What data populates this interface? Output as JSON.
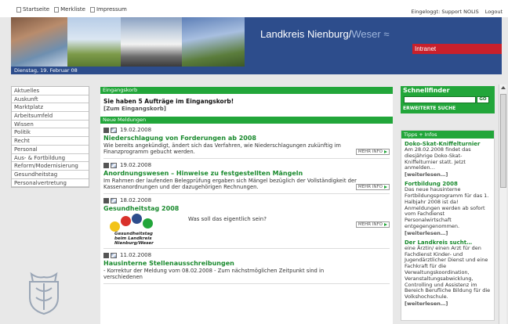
{
  "toplinks": [
    {
      "label": "Startseite",
      "icon": "home-icon"
    },
    {
      "label": "Merkliste",
      "icon": "doc-icon"
    },
    {
      "label": "Impressum",
      "icon": "doc-icon"
    }
  ],
  "user": {
    "logged_in": "Eingeloggt: Support NOLIS",
    "logout": "Logout"
  },
  "banner": {
    "title_main": "Landkreis Nienburg/",
    "title_accent": "Weser",
    "waves": "≈",
    "intranet": "Intranet",
    "date": "Dienstag, 19. Februar 08"
  },
  "nav": [
    "Aktuelles",
    "Auskunft",
    "Marktplatz",
    "Arbeitsumfeld",
    "Wissen",
    "Politik",
    "Recht",
    "Personal",
    "Aus- & Fortbildung",
    "Reform/Modernisierung",
    "Gesundheitstag",
    "Personalvertretung"
  ],
  "inbox": {
    "header": "Eingangskorb",
    "message": "Sie haben 5 Aufträge im Eingangskorb!",
    "link": "[Zum Eingangskorb]"
  },
  "news": {
    "header": "Neue Meldungen",
    "more_label": "MEHR INFO",
    "items": [
      {
        "date": "19.02.2008",
        "title": "Niederschlagung von Forderungen ab 2008",
        "text": "Wie bereits angekündigt, ändert sich das Verfahren, wie Niederschlagungen zukünftig im Finanzprogramm gebucht werden."
      },
      {
        "date": "19.02.2008",
        "title": "Anordnungswesen – Hinweise zu festgestellten Mängeln",
        "text": "Im Rahmen der laufenden Belegprüfung ergaben sich Mängel bezüglich der Vollständigkeit der Kassenanordnungen und der dazugehörigen Rechnungen."
      },
      {
        "date": "18.02.2008",
        "title": "Gesundheitstag 2008",
        "question": "Was soll das eigentlich sein?",
        "logo_line1": "Gesundheitstag",
        "logo_line2": "beim Landkreis Nienburg/Weser"
      },
      {
        "date": "11.02.2008",
        "title": "Hausinterne Stellenausschreibungen",
        "text": "- Korrektur der Meldung vom 08.02.2008 - Zum nächstmöglichen Zeitpunkt sind in verschiedenen"
      }
    ]
  },
  "finder": {
    "title": "Schnellfinder",
    "go": "GO",
    "advanced": "ERWEITERTE SUCHE"
  },
  "tips": {
    "header": "Tipps + Infos",
    "items": [
      {
        "title": "Doko-Skat-Kniffelturnier",
        "text": "Am 28.02.2008 findet das diesjährige Doko-Skat-Kniffelturnier statt. Jetzt anmelden…",
        "more": "[weiterlesen…]"
      },
      {
        "title": "Fortbildung 2008",
        "text": "Das neue hausinterne Fortbildungsprogramm für das 1. Halbjahr 2008 ist da! Anmeldungen werden ab sofort vom Fachdienst Personalwirtschaft entgegengenommen.",
        "more": "[weiterlesen…]"
      },
      {
        "title": "Der Landkreis sucht…",
        "text": "eine Ärztin/ einen Arzt für den Fachdienst Kinder- und Jugendärztlicher Dienst und eine Fachkraft für die Verwaltungskoordination, Veranstaltungsabwicklung, Controlling und Assistenz im Bereich Berufliche Bildung für die Volkshochschule.",
        "more": "[weiterlesen…]"
      }
    ]
  },
  "colors": {
    "brand_blue": "#2d4d8c",
    "green": "#22a63a",
    "red": "#c8202b"
  }
}
